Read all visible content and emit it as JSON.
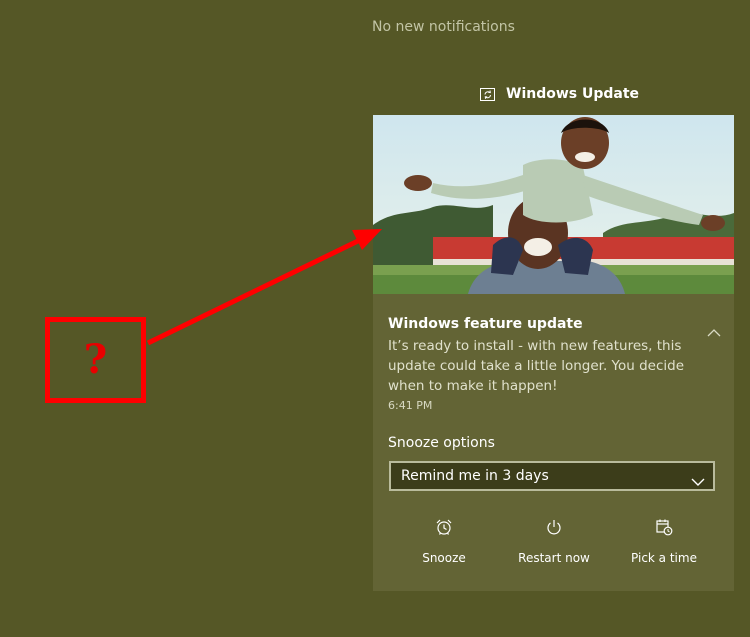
{
  "notification_center": {
    "empty_text": "No new notifications"
  },
  "group": {
    "app_name": "Windows Update",
    "icon": "windows-update-icon"
  },
  "notification": {
    "hero_image": "photo-father-with-child-on-shoulders",
    "title": "Windows feature update",
    "body": "It’s ready to install - with new features, this update could take a little longer. You decide when to make it happen!",
    "time": "6:41 PM",
    "snooze_label": "Snooze options",
    "snooze_selected": "Remind me in 3 days",
    "actions": [
      {
        "label": "Snooze",
        "icon": "alarm-clock-icon"
      },
      {
        "label": "Restart now",
        "icon": "power-icon"
      },
      {
        "label": "Pick a time",
        "icon": "calendar-clock-icon"
      }
    ]
  },
  "annotation": {
    "question_mark": "?",
    "color": "#ff0000"
  },
  "colors": {
    "background": "#555726",
    "card": "#636435",
    "dropdown_bg": "#3c3d1a"
  }
}
